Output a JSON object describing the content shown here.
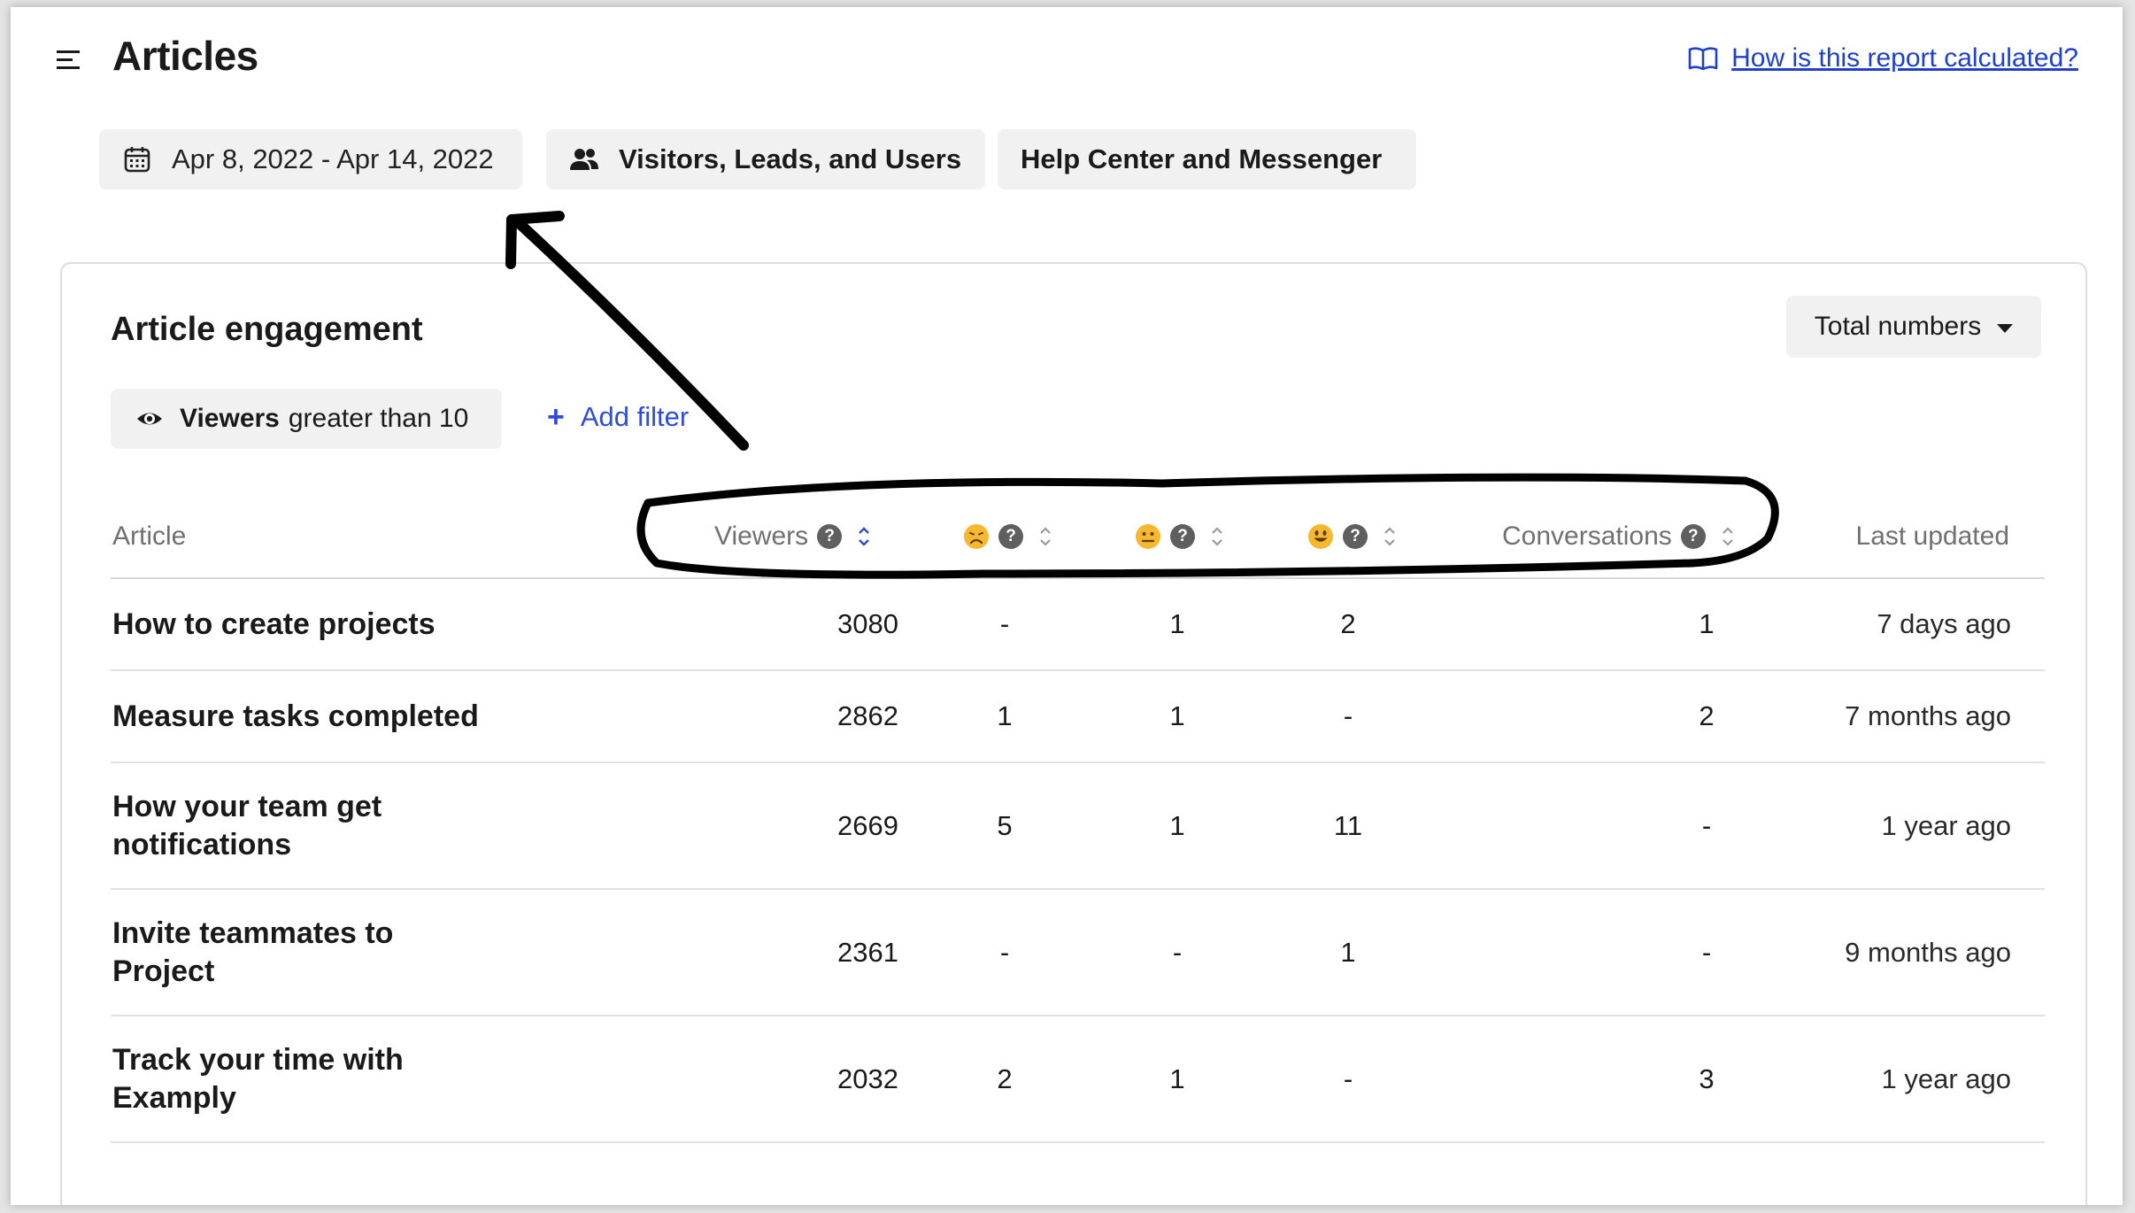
{
  "header": {
    "title": "Articles",
    "help_link": "How is this report calculated?"
  },
  "filters": {
    "date_range": "Apr 8, 2022 - Apr 14, 2022",
    "audience": "Visitors, Leads, and Users",
    "channel": "Help Center and Messenger"
  },
  "card": {
    "title": "Article engagement",
    "mode_dropdown": "Total numbers",
    "filter_chip": {
      "field": "Viewers",
      "condition": "greater than 10"
    },
    "add_filter": "Add filter"
  },
  "table": {
    "columns": {
      "article": "Article",
      "viewers": "Viewers",
      "conversations": "Conversations",
      "last_updated": "Last updated"
    },
    "reaction_icons": [
      "sad-emoji-icon",
      "neutral-emoji-icon",
      "happy-emoji-icon"
    ],
    "rows": [
      {
        "title": "How to create projects",
        "viewers": "3080",
        "sad": "-",
        "neutral": "1",
        "happy": "2",
        "conversations": "1",
        "updated": "7 days ago"
      },
      {
        "title": "Measure tasks completed",
        "viewers": "2862",
        "sad": "1",
        "neutral": "1",
        "happy": "-",
        "conversations": "2",
        "updated": "7 months ago"
      },
      {
        "title": "How your team get notifications",
        "viewers": "2669",
        "sad": "5",
        "neutral": "1",
        "happy": "11",
        "conversations": "-",
        "updated": "1 year ago"
      },
      {
        "title": "Invite teammates to Project",
        "viewers": "2361",
        "sad": "-",
        "neutral": "-",
        "happy": "1",
        "conversations": "-",
        "updated": "9 months ago"
      },
      {
        "title": "Track your time with Examply",
        "viewers": "2032",
        "sad": "2",
        "neutral": "1",
        "happy": "-",
        "conversations": "3",
        "updated": "1 year ago"
      }
    ]
  },
  "colors": {
    "link": "#1f3fcf",
    "accent": "#2f4cdf",
    "emoji": "#f5b82e",
    "annotation": "#000000"
  }
}
